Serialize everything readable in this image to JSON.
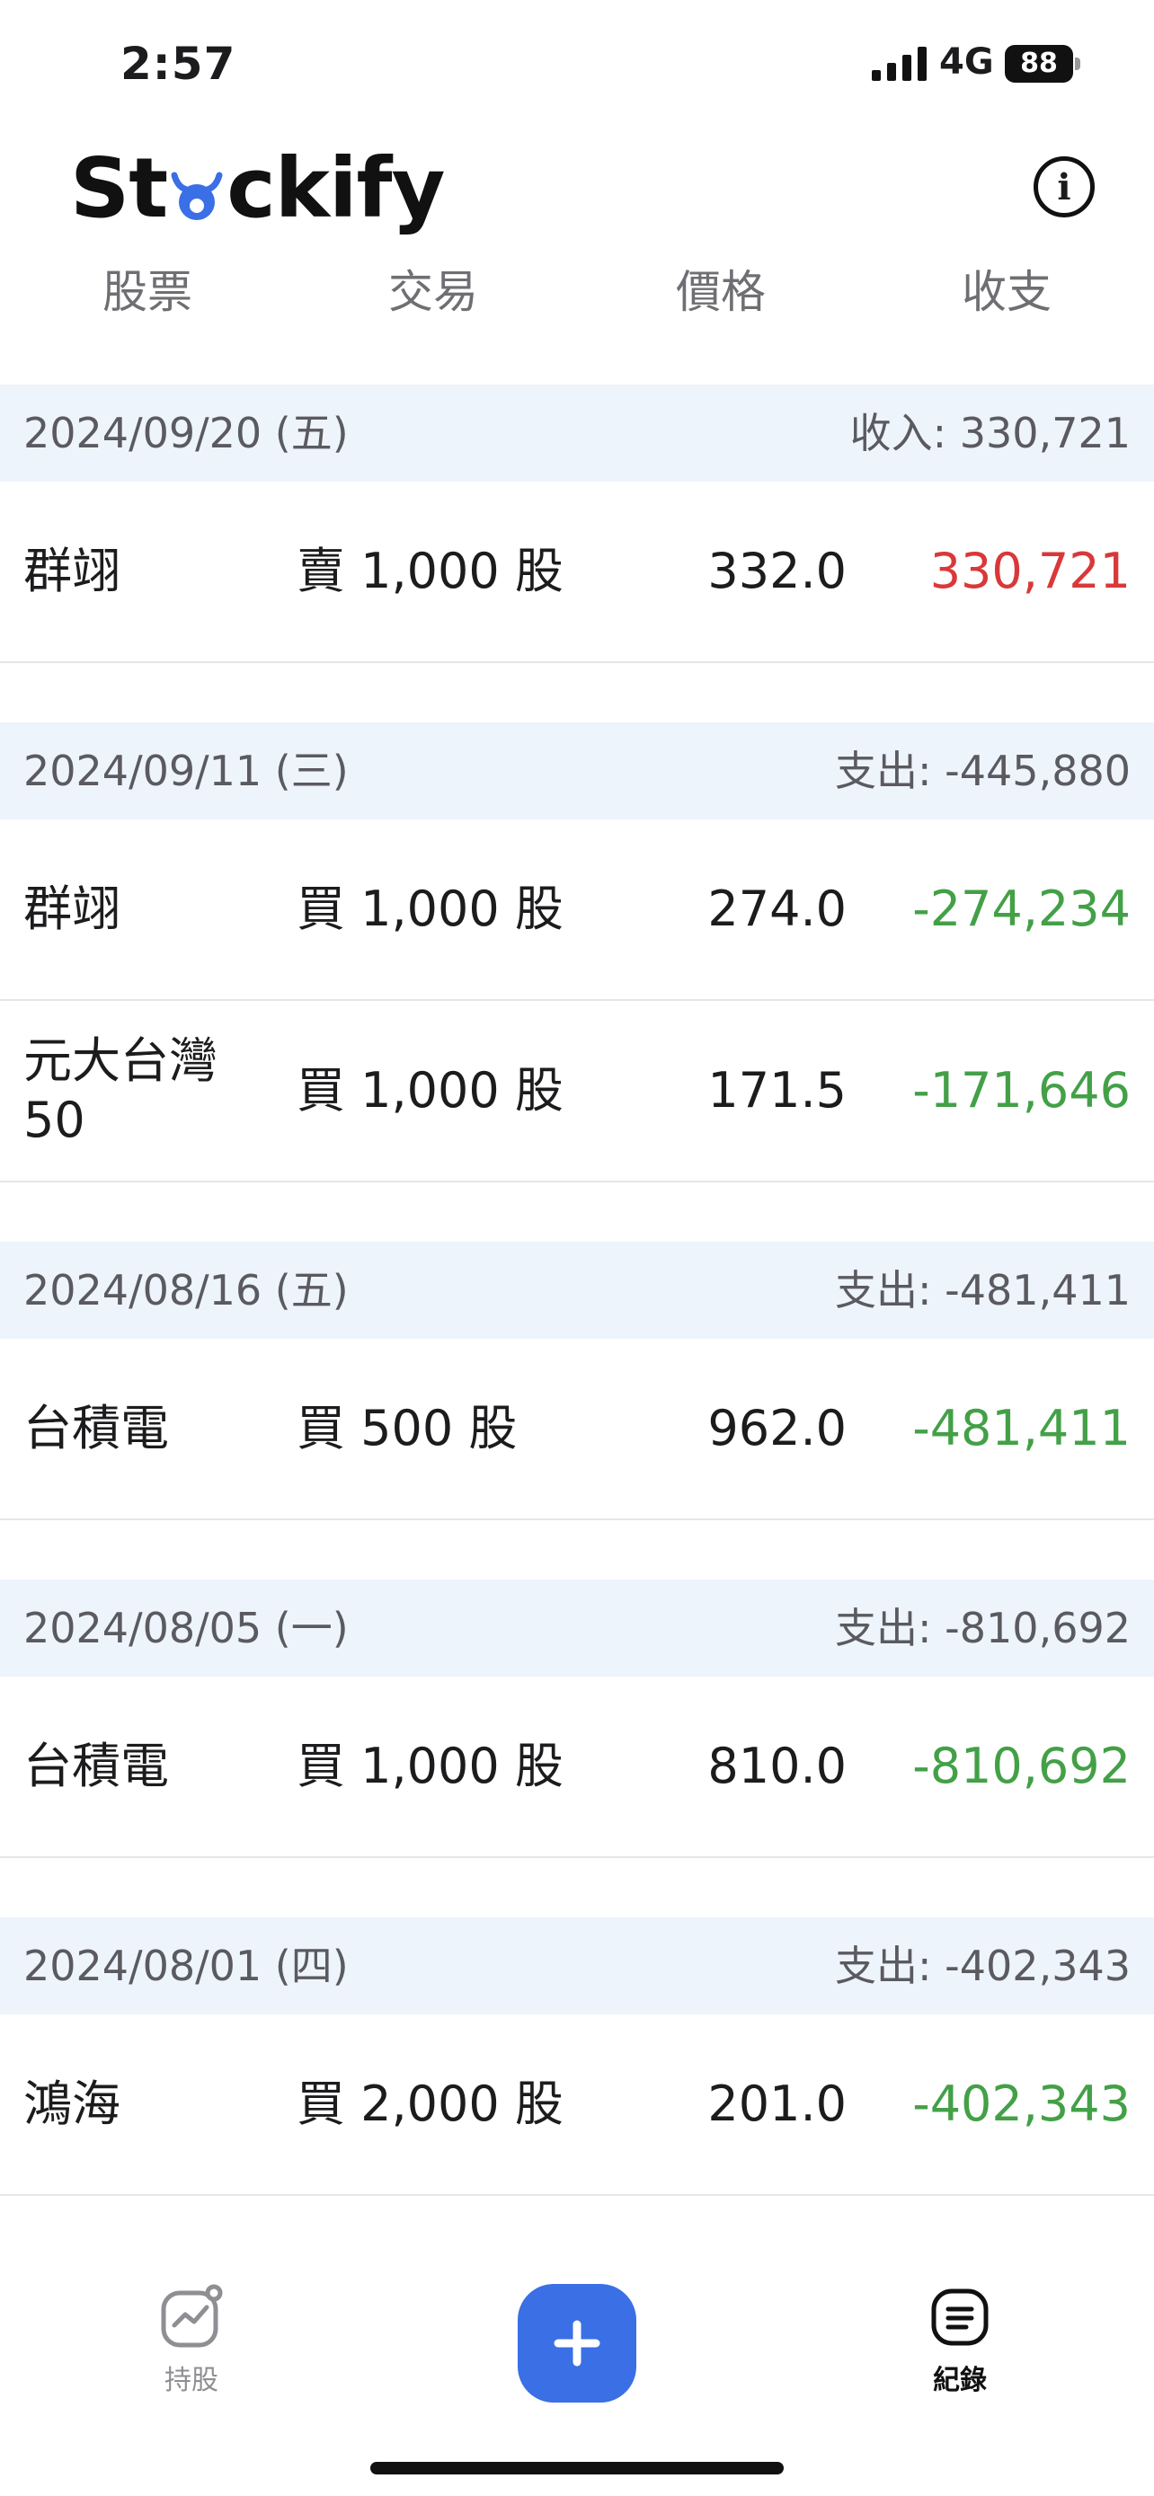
{
  "status_bar": {
    "time": "2:57",
    "network": "4G",
    "battery": "88"
  },
  "header": {
    "logo_prefix": "St",
    "logo_suffix": "ckify",
    "logo_accent_color": "#3a6fe5",
    "info_icon": "info-icon"
  },
  "tabs": [
    {
      "label": "股票"
    },
    {
      "label": "交易"
    },
    {
      "label": "價格"
    },
    {
      "label": "收支"
    }
  ],
  "groups": [
    {
      "date": "2024/09/20 (五)",
      "total": "收入: 330,721",
      "rows": [
        {
          "name": "群翊",
          "action": "賣 1,000 股",
          "price": "332.0",
          "amount": "330,721",
          "type": "income"
        }
      ]
    },
    {
      "date": "2024/09/11 (三)",
      "total": "支出: -445,880",
      "rows": [
        {
          "name": "群翊",
          "action": "買 1,000 股",
          "price": "274.0",
          "amount": "-274,234",
          "type": "expense"
        },
        {
          "name": "元大台灣50",
          "action": "買 1,000 股",
          "price": "171.5",
          "amount": "-171,646",
          "type": "expense"
        }
      ]
    },
    {
      "date": "2024/08/16 (五)",
      "total": "支出: -481,411",
      "rows": [
        {
          "name": "台積電",
          "action": "買 500 股",
          "price": "962.0",
          "amount": "-481,411",
          "type": "expense"
        }
      ]
    },
    {
      "date": "2024/08/05 (一)",
      "total": "支出: -810,692",
      "rows": [
        {
          "name": "台積電",
          "action": "買 1,000 股",
          "price": "810.0",
          "amount": "-810,692",
          "type": "expense"
        }
      ]
    },
    {
      "date": "2024/08/01 (四)",
      "total": "支出: -402,343",
      "rows": [
        {
          "name": "鴻海",
          "action": "買 2,000 股",
          "price": "201.0",
          "amount": "-402,343",
          "type": "expense"
        }
      ]
    }
  ],
  "colors": {
    "income": "#d9383a",
    "expense": "#43a047",
    "group_header_bg": "#eef4fc",
    "primary": "#3a6fe5"
  },
  "bottom_nav": {
    "holdings": {
      "label": "持股",
      "icon": "chart-icon"
    },
    "add": {
      "icon": "plus-icon"
    },
    "records": {
      "label": "紀錄",
      "icon": "list-icon"
    }
  }
}
